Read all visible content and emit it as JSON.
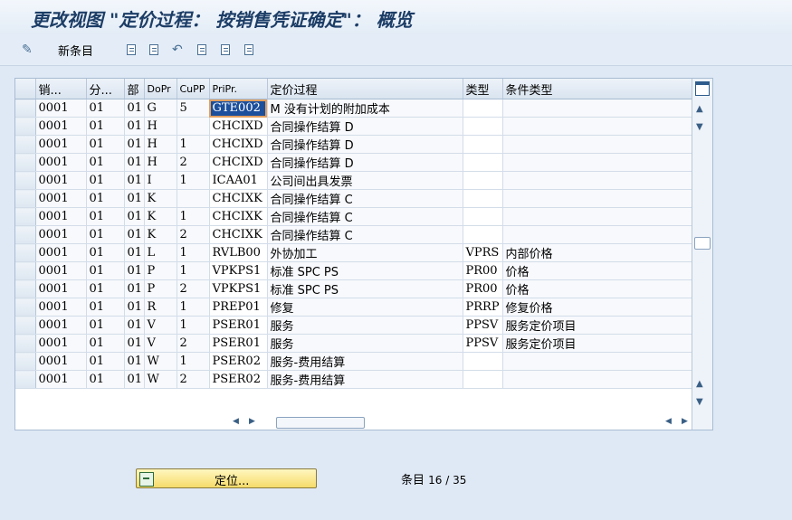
{
  "title": "更改视图 \"定价过程： 按销售凭证确定\"： 概览",
  "toolbar": {
    "new_entries_label": "新条目"
  },
  "table": {
    "headers": [
      "销...",
      "分...",
      "部",
      "DoPr",
      "CuPP",
      "PriPr.",
      "定价过程",
      "类型",
      "条件类型"
    ],
    "rows": [
      [
        "0001",
        "01",
        "01",
        "G",
        "5",
        "GTE002",
        "M 没有计划的附加成本",
        "",
        ""
      ],
      [
        "0001",
        "01",
        "01",
        "H",
        "",
        "CHCIXD",
        "合同操作结算 D",
        "",
        ""
      ],
      [
        "0001",
        "01",
        "01",
        "H",
        "1",
        "CHCIXD",
        "合同操作结算 D",
        "",
        ""
      ],
      [
        "0001",
        "01",
        "01",
        "H",
        "2",
        "CHCIXD",
        "合同操作结算 D",
        "",
        ""
      ],
      [
        "0001",
        "01",
        "01",
        "I",
        "1",
        "ICAA01",
        "公司间出具发票",
        "",
        ""
      ],
      [
        "0001",
        "01",
        "01",
        "K",
        "",
        "CHCIXK",
        "合同操作结算 C",
        "",
        ""
      ],
      [
        "0001",
        "01",
        "01",
        "K",
        "1",
        "CHCIXK",
        "合同操作结算 C",
        "",
        ""
      ],
      [
        "0001",
        "01",
        "01",
        "K",
        "2",
        "CHCIXK",
        "合同操作结算 C",
        "",
        ""
      ],
      [
        "0001",
        "01",
        "01",
        "L",
        "1",
        "RVLB00",
        "外协加工",
        "VPRS",
        "内部价格"
      ],
      [
        "0001",
        "01",
        "01",
        "P",
        "1",
        "VPKPS1",
        "标准 SPC PS",
        "PR00",
        "价格"
      ],
      [
        "0001",
        "01",
        "01",
        "P",
        "2",
        "VPKPS1",
        "标准 SPC PS",
        "PR00",
        "价格"
      ],
      [
        "0001",
        "01",
        "01",
        "R",
        "1",
        "PREP01",
        "修复",
        "PRRP",
        "修复价格"
      ],
      [
        "0001",
        "01",
        "01",
        "V",
        "1",
        "PSER01",
        "服务",
        "PPSV",
        "服务定价项目"
      ],
      [
        "0001",
        "01",
        "01",
        "V",
        "2",
        "PSER01",
        "服务",
        "PPSV",
        "服务定价项目"
      ],
      [
        "0001",
        "01",
        "01",
        "W",
        "1",
        "PSER02",
        "服务-费用结算",
        "",
        ""
      ],
      [
        "0001",
        "01",
        "01",
        "W",
        "2",
        "PSER02",
        "服务-费用结算",
        "",
        ""
      ]
    ]
  },
  "position_button": {
    "label": "定位..."
  },
  "entry_count": {
    "label": "条目",
    "value": "16 / 35"
  }
}
